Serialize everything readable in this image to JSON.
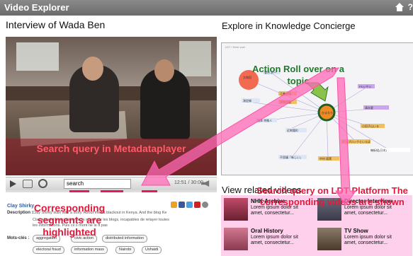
{
  "app": {
    "title": "Video Explorer",
    "help": "?"
  },
  "left": {
    "heading": "Interview of Wada Ben",
    "annotation_search": "Search query in Metadataplayer",
    "search_value": "search",
    "time": "12:51 / 30:00",
    "speaker": "Clay Shirky",
    "description_label": "Description :",
    "description_line1": "Clay Shirky start with a story. About media blackout in Kenya. And the blog Ke",
    "description_line2": "Clay aborde la problème de la surinfo pr les blogs, incapables de relayer toutes",
    "description_line3": "les informations. Puis ce il mont ne le ft pas",
    "annotation_segments": "Corresponding segments are highlighted",
    "tags_label": "Mots-clés :",
    "tags": [
      "aggregation",
      "civic action",
      "distributed information",
      "electoral fraud",
      "information mass",
      "Nairobi",
      "Ushaidi"
    ]
  },
  "right": {
    "heading": "Explore in Knowledge Concierge",
    "crumb": "LDT / Kern vuel",
    "annotation_action": "Action Roll over on a topic",
    "node_labels": [
      "大和田",
      "會合 あー",
      "測定線",
      "正義全体",
      "学等活動",
      "団体 特殊人",
      "PDいやい",
      "清水愛",
      "小田子山いる",
      "近刺電町",
      "ヒップロックといえば",
      "機板組(日本)",
      "不思議「新しい」",
      "中村 孤実",
      "ひまわり"
    ]
  },
  "related": {
    "heading": "View related videos",
    "annotation": "Search query on LDT Platform The corresponding videos are shown",
    "items": [
      {
        "title": "NHK Archive",
        "desc": "Lorem ipsum dolor sit amet, consectetur..."
      },
      {
        "title": "Director Interview",
        "desc": "Lorem ipsum dolor sit amet, consectetur..."
      },
      {
        "title": "Oral History",
        "desc": "Lorem ipsum dolor sit amet, consectetur..."
      },
      {
        "title": "TV Show",
        "desc": "Lorem ipsum dolor sit amet, consectetur..."
      }
    ]
  },
  "colors": {
    "accent": "#e01a3c",
    "green": "#1e7a2a",
    "link": "#2f5d9e",
    "pink": "#ff78c8"
  }
}
